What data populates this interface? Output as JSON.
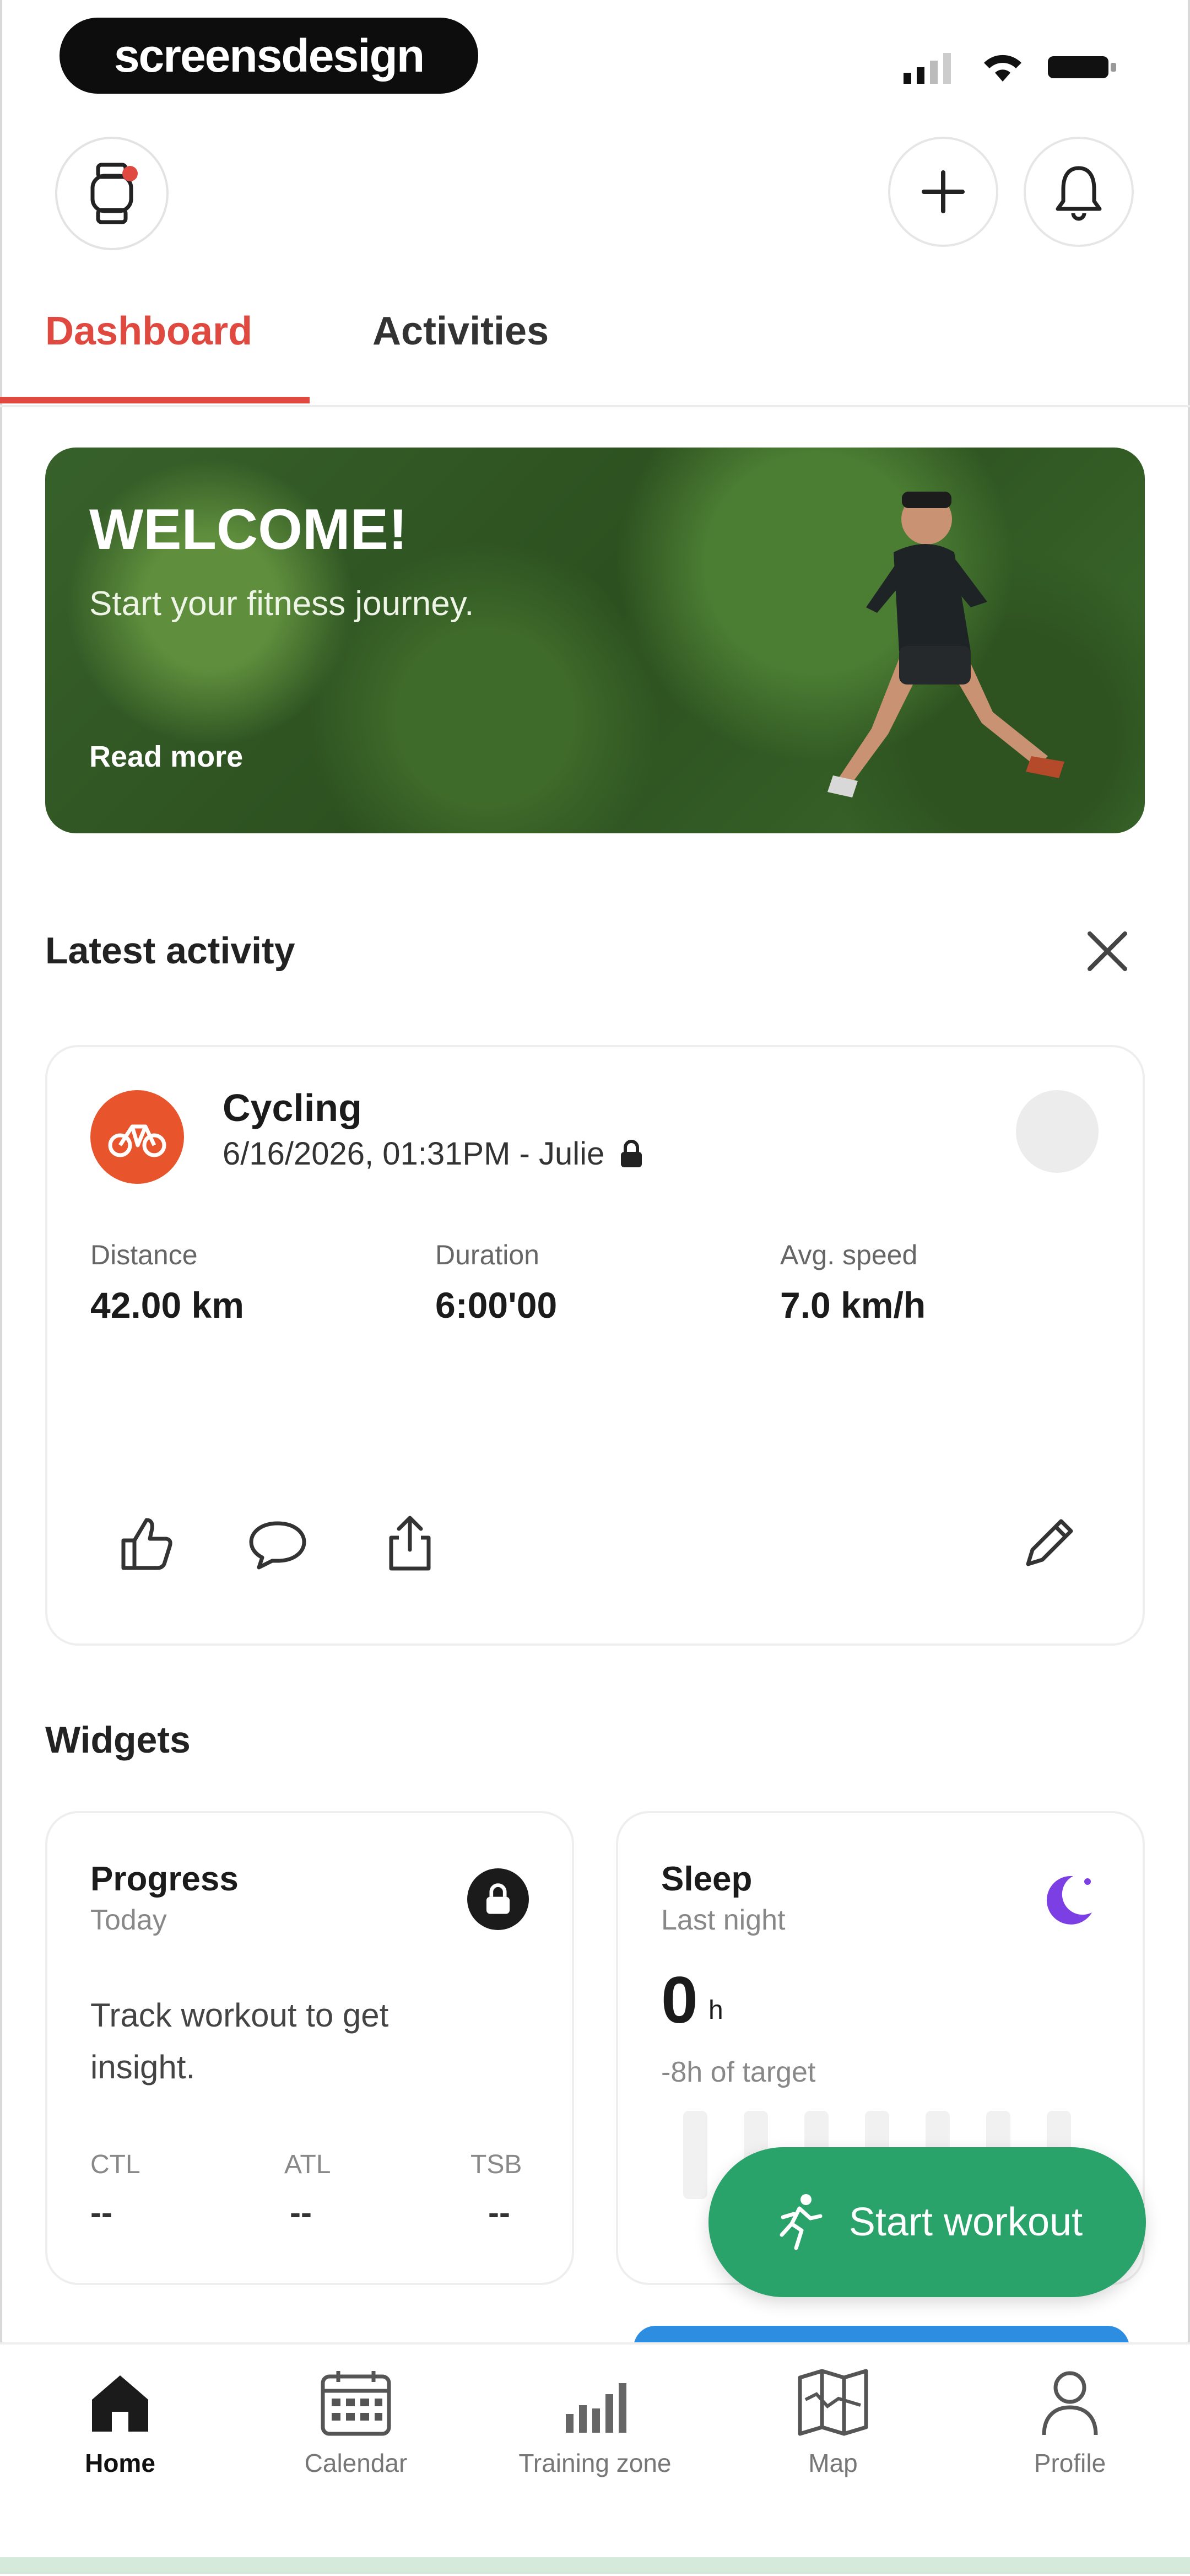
{
  "status_bar": {
    "brand": "screensdesign"
  },
  "top_bar": {
    "avatar_icon": "watch-icon",
    "add_icon": "plus-icon",
    "bell_icon": "bell-icon"
  },
  "tabs": [
    {
      "label": "Dashboard",
      "active": true
    },
    {
      "label": "Activities",
      "active": false
    }
  ],
  "hero": {
    "title": "WELCOME!",
    "subtitle": "Start your fitness journey.",
    "link": "Read more"
  },
  "latest_activity": {
    "section_title": "Latest activity",
    "type": "Cycling",
    "meta": "6/16/2026, 01:31PM - Julie",
    "stats": [
      {
        "label": "Distance",
        "value": "42.00 km"
      },
      {
        "label": "Duration",
        "value": "6:00'00"
      },
      {
        "label": "Avg. speed",
        "value": "7.0 km/h"
      }
    ]
  },
  "widgets": {
    "section_title": "Widgets",
    "progress": {
      "title": "Progress",
      "subtitle": "Today",
      "text": "Track workout to get insight.",
      "metrics": [
        {
          "label": "CTL",
          "value": "--"
        },
        {
          "label": "ATL",
          "value": "--"
        },
        {
          "label": "TSB",
          "value": "--"
        }
      ]
    },
    "sleep": {
      "title": "Sleep",
      "subtitle": "Last night",
      "value": "0",
      "unit": "h",
      "target": "-8h of target"
    }
  },
  "fab": {
    "label": "Start workout"
  },
  "colors": {
    "accent": "#e0493f",
    "fab": "#2aa36b",
    "activity": "#e8542b"
  },
  "bottom_nav": [
    {
      "label": "Home",
      "icon": "home-icon",
      "active": true
    },
    {
      "label": "Calendar",
      "icon": "calendar-icon",
      "active": false
    },
    {
      "label": "Training zone",
      "icon": "chart-bars-icon",
      "active": false
    },
    {
      "label": "Map",
      "icon": "map-icon",
      "active": false
    },
    {
      "label": "Profile",
      "icon": "person-icon",
      "active": false
    }
  ]
}
